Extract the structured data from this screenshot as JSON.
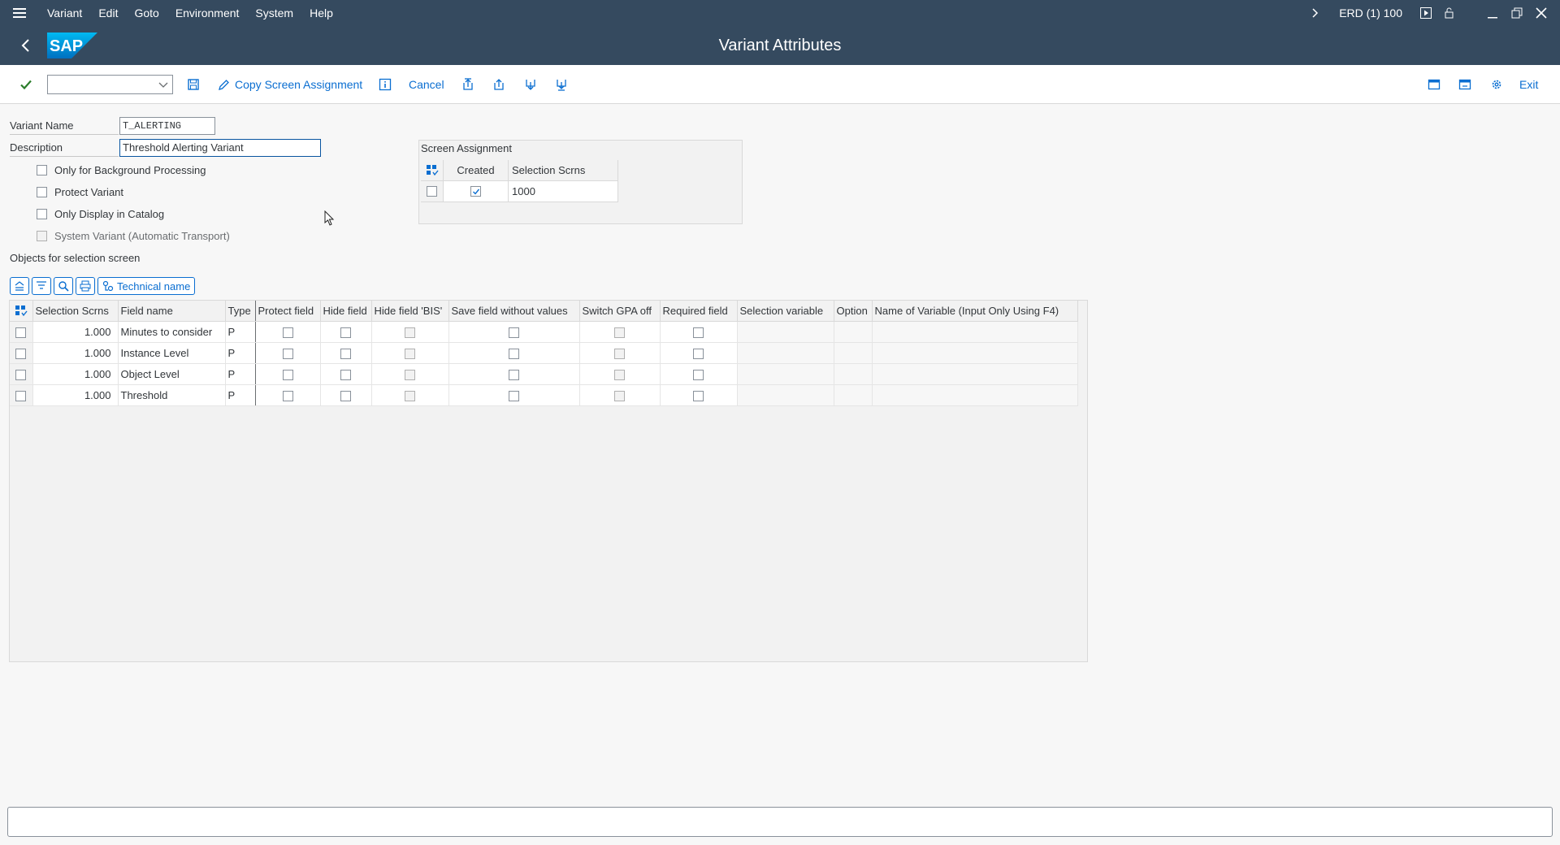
{
  "menu": {
    "items": [
      "Variant",
      "Edit",
      "Goto",
      "Environment",
      "System",
      "Help"
    ]
  },
  "system": {
    "session": "ERD (1) 100"
  },
  "title": "Variant Attributes",
  "logo_text": "SAP",
  "toolbar": {
    "copy_screen_assignment": "Copy Screen Assignment",
    "cancel": "Cancel",
    "exit": "Exit",
    "command_field_value": ""
  },
  "form": {
    "variant_name_label": "Variant Name",
    "variant_name_value": "T_ALERTING",
    "description_label": "Description",
    "description_value": "Threshold Alerting Variant",
    "options": [
      {
        "label": "Only for Background Processing",
        "checked": false,
        "disabled": false
      },
      {
        "label": "Protect Variant",
        "checked": false,
        "disabled": false
      },
      {
        "label": "Only Display in Catalog",
        "checked": false,
        "disabled": false
      },
      {
        "label": "System Variant (Automatic Transport)",
        "checked": false,
        "disabled": true
      }
    ]
  },
  "screen_assignment": {
    "title": "Screen Assignment",
    "headers": [
      "Created",
      "Selection Scrns"
    ],
    "rows": [
      {
        "created": true,
        "screen": "1000"
      }
    ]
  },
  "objects": {
    "title": "Objects for selection screen",
    "technical_name_button": "Technical name",
    "headers": [
      "Selection Scrns",
      "Field name",
      "Type",
      "Protect field",
      "Hide field",
      "Hide field 'BIS'",
      "Save field without values",
      "Switch GPA off",
      "Required field",
      "Selection variable",
      "Option",
      "Name of Variable (Input Only Using F4)"
    ],
    "rows": [
      {
        "screen": "1.000",
        "field": "Minutes to consider",
        "type": "P"
      },
      {
        "screen": "1.000",
        "field": "Instance Level",
        "type": "P"
      },
      {
        "screen": "1.000",
        "field": "Object Level",
        "type": "P"
      },
      {
        "screen": "1.000",
        "field": "Threshold",
        "type": "P"
      }
    ]
  },
  "colors": {
    "shell": "#354a5f",
    "accent": "#0a6ed1",
    "background": "#f7f7f7"
  }
}
